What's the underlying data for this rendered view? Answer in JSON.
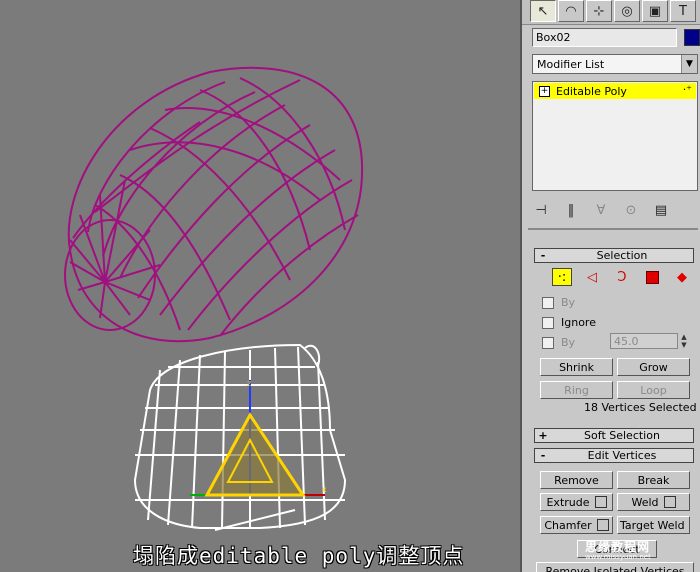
{
  "viewport": {
    "caption": "塌陷成editable poly调整顶点"
  },
  "command_panel": {
    "tabs": [
      {
        "icon": "create-arrow-icon"
      },
      {
        "icon": "modify-icon"
      },
      {
        "icon": "hierarchy-icon"
      },
      {
        "icon": "motion-icon"
      },
      {
        "icon": "display-icon"
      },
      {
        "icon": "utilities-icon"
      }
    ],
    "object_name": "Box02",
    "object_color": "#00008b",
    "modifier_list_label": "Modifier List",
    "stack_item": "Editable Poly",
    "selection": {
      "title": "Selection",
      "by_vertex": "By",
      "ignore_backfacing": "Ignore",
      "by_angle": "By",
      "angle_value": "45.0",
      "shrink": "Shrink",
      "grow": "Grow",
      "ring": "Ring",
      "loop": "Loop",
      "status": "18 Vertices Selected"
    },
    "soft_selection_title": "Soft Selection",
    "edit_vertices": {
      "title": "Edit Vertices",
      "remove": "Remove",
      "break": "Break",
      "extrude": "Extrude",
      "weld": "Weld",
      "chamfer": "Chamfer",
      "target_weld": "Target Weld",
      "connect": "Connect",
      "remove_isolated": "Remove Isolated Vertices"
    }
  },
  "watermark": {
    "line1": "思缘教程网",
    "line2": "www.missyuan.net"
  },
  "colors": {
    "viewport_bg": "#7b7b7b",
    "upper_mesh": "#a0107f",
    "lower_mesh": "#ffffff",
    "gizmo": "#ffd400",
    "highlight": "#ffff00"
  }
}
